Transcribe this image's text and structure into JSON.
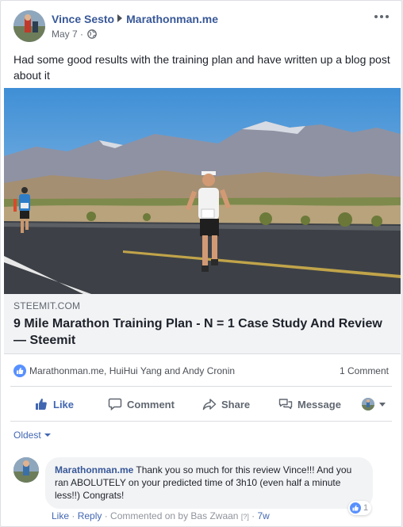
{
  "header": {
    "author": "Vince Sesto",
    "target": "Marathonman.me",
    "date": "May 7",
    "separator": " · "
  },
  "post": {
    "text": "Had some good results with the training plan and have written up a blog post about it"
  },
  "link_preview": {
    "domain": "STEEMIT.COM",
    "title": "9 Mile Marathon Training Plan - N = 1 Case Study And Review — Steemit"
  },
  "reactions": {
    "names": "Marathonman.me, HuiHui Yang and Andy Cronin",
    "comment_count": "1 Comment"
  },
  "actions": {
    "like": "Like",
    "comment": "Comment",
    "share": "Share",
    "message": "Message"
  },
  "comments": {
    "sort_label": "Oldest",
    "items": [
      {
        "author": "Marathonman.me",
        "text": "Thank you so much for this review Vince!!! And you ran ABOLUTELY on your predicted time of 3h10 (even half a minute less!!) Congrats!",
        "like_count": "1",
        "like_label": "Like",
        "reply_label": "Reply",
        "commented_on": "Commented on by Bas Zwaan",
        "help_mark": "[?]",
        "age": "7w",
        "dot": " · "
      }
    ]
  },
  "colors": {
    "link_blue": "#385898",
    "action_blue": "#4267b2",
    "like_blue": "#5890ff",
    "muted": "#606770"
  }
}
